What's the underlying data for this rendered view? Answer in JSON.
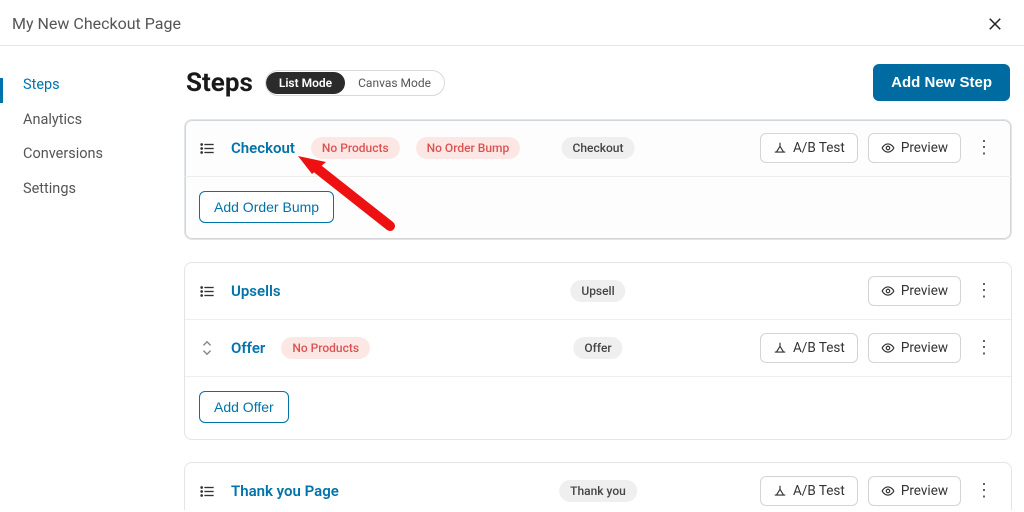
{
  "window": {
    "title": "My New Checkout Page"
  },
  "sidebar": {
    "items": [
      {
        "label": "Steps"
      },
      {
        "label": "Analytics"
      },
      {
        "label": "Conversions"
      },
      {
        "label": "Settings"
      }
    ]
  },
  "page": {
    "title": "Steps",
    "mode_list": "List Mode",
    "mode_canvas": "Canvas Mode",
    "add_step": "Add New Step"
  },
  "buttons": {
    "abtest": "A/B Test",
    "preview": "Preview",
    "add_order_bump": "Add Order Bump",
    "add_offer": "Add Offer"
  },
  "warn": {
    "no_products": "No Products",
    "no_order_bump": "No Order Bump"
  },
  "type": {
    "checkout": "Checkout",
    "upsell": "Upsell",
    "offer": "Offer",
    "thankyou": "Thank you"
  },
  "steps": {
    "checkout": "Checkout",
    "upsells": "Upsells",
    "offer": "Offer",
    "thankyou": "Thank you Page"
  }
}
